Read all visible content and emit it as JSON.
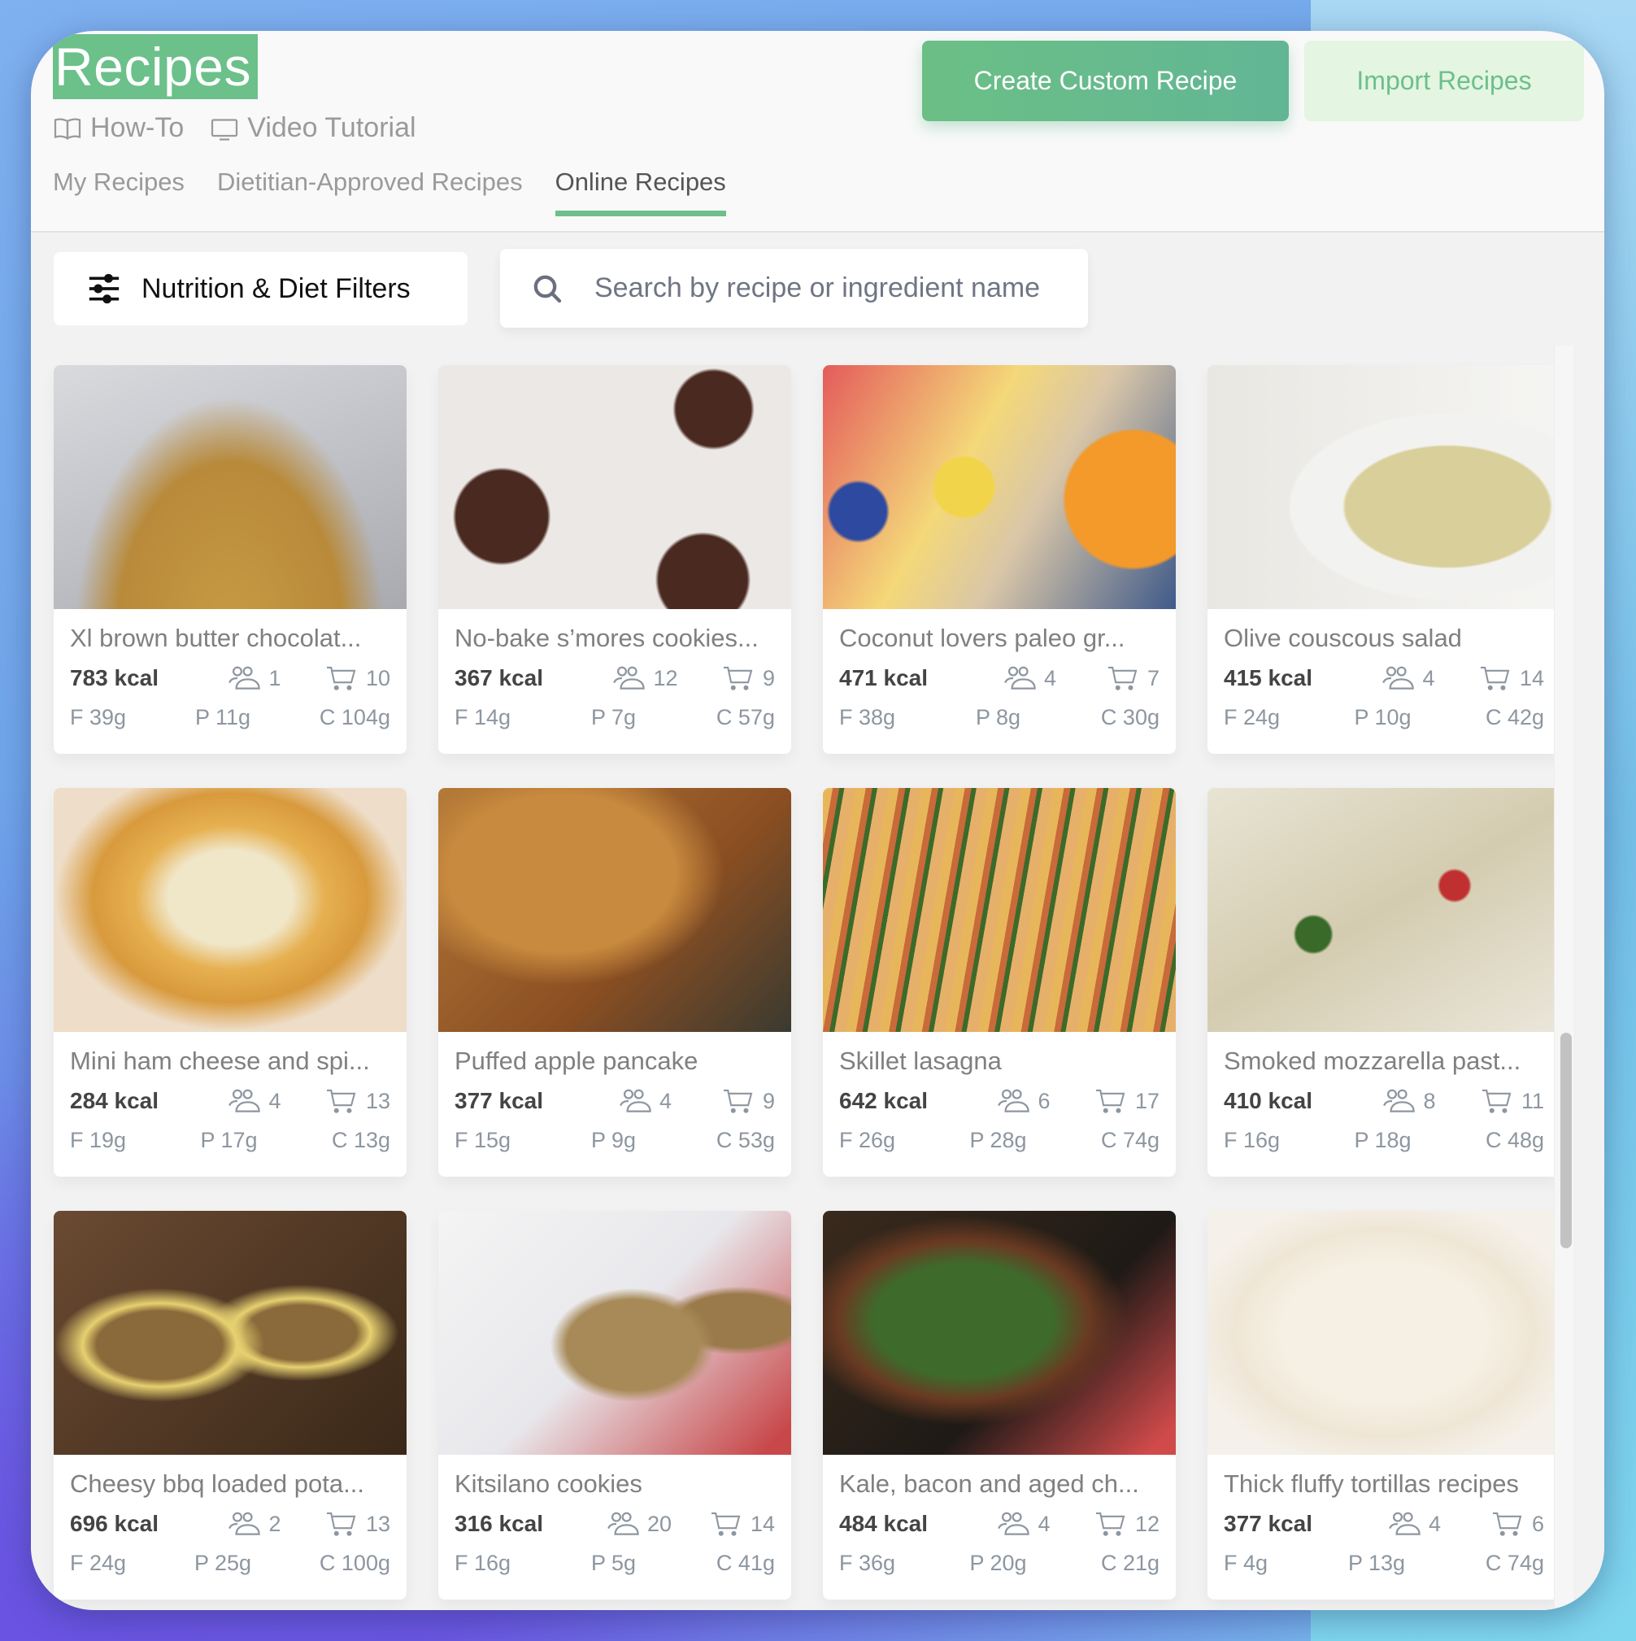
{
  "header": {
    "title": "Recipes",
    "help_links": [
      {
        "label": "How-To",
        "icon": "book-open-icon"
      },
      {
        "label": "Video Tutorial",
        "icon": "monitor-icon"
      }
    ],
    "create_button": "Create Custom Recipe",
    "import_button": "Import Recipes"
  },
  "tabs": [
    {
      "label": "My Recipes",
      "active": false
    },
    {
      "label": "Dietitian-Approved Recipes",
      "active": false
    },
    {
      "label": "Online Recipes",
      "active": true
    }
  ],
  "toolbar": {
    "filters_label": "Nutrition & Diet Filters",
    "filters_icon": "sliders-icon",
    "search_placeholder": "Search by recipe or ingredient name",
    "search_value": "",
    "search_icon": "search-icon"
  },
  "colors": {
    "accent": "#6cc08a",
    "import_bg": "#e4f5e2",
    "muted_text": "#8d96a0"
  },
  "scrollbar": {
    "position_fraction": 0.58
  },
  "recipes": [
    {
      "name": "Xl brown butter chocolat...",
      "kcal": "783 kcal",
      "servings": "1",
      "ingredients": "10",
      "fat": "F 39g",
      "protein": "P 11g",
      "carbs": "C 104g"
    },
    {
      "name": "No-bake s’mores cookies...",
      "kcal": "367 kcal",
      "servings": "12",
      "ingredients": "9",
      "fat": "F 14g",
      "protein": "P 7g",
      "carbs": "C 57g"
    },
    {
      "name": "Coconut lovers paleo gr...",
      "kcal": "471 kcal",
      "servings": "4",
      "ingredients": "7",
      "fat": "F 38g",
      "protein": "P 8g",
      "carbs": "C 30g"
    },
    {
      "name": "Olive couscous salad",
      "kcal": "415 kcal",
      "servings": "4",
      "ingredients": "14",
      "fat": "F 24g",
      "protein": "P 10g",
      "carbs": "C 42g"
    },
    {
      "name": "Mini ham cheese and spi...",
      "kcal": "284 kcal",
      "servings": "4",
      "ingredients": "13",
      "fat": "F 19g",
      "protein": "P 17g",
      "carbs": "C 13g"
    },
    {
      "name": "Puffed apple pancake",
      "kcal": "377 kcal",
      "servings": "4",
      "ingredients": "9",
      "fat": "F 15g",
      "protein": "P 9g",
      "carbs": "C 53g"
    },
    {
      "name": "Skillet lasagna",
      "kcal": "642 kcal",
      "servings": "6",
      "ingredients": "17",
      "fat": "F 26g",
      "protein": "P 28g",
      "carbs": "C 74g"
    },
    {
      "name": "Smoked mozzarella past...",
      "kcal": "410 kcal",
      "servings": "8",
      "ingredients": "11",
      "fat": "F 16g",
      "protein": "P 18g",
      "carbs": "C 48g"
    },
    {
      "name": "Cheesy bbq loaded pota...",
      "kcal": "696 kcal",
      "servings": "2",
      "ingredients": "13",
      "fat": "F 24g",
      "protein": "P 25g",
      "carbs": "C 100g"
    },
    {
      "name": "Kitsilano cookies",
      "kcal": "316 kcal",
      "servings": "20",
      "ingredients": "14",
      "fat": "F 16g",
      "protein": "P 5g",
      "carbs": "C 41g"
    },
    {
      "name": "Kale, bacon and aged ch...",
      "kcal": "484 kcal",
      "servings": "4",
      "ingredients": "12",
      "fat": "F 36g",
      "protein": "P 20g",
      "carbs": "C 21g"
    },
    {
      "name": "Thick fluffy tortillas recipes",
      "kcal": "377 kcal",
      "servings": "4",
      "ingredients": "6",
      "fat": "F 4g",
      "protein": "P 13g",
      "carbs": "C 74g"
    }
  ]
}
